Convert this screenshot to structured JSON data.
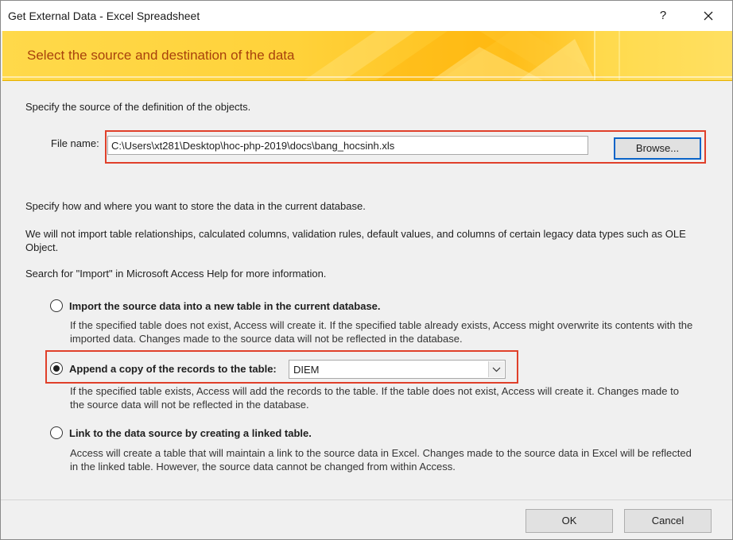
{
  "window": {
    "title": "Get External Data - Excel Spreadsheet",
    "help_label": "?"
  },
  "banner": {
    "title": "Select the source and destination of the data"
  },
  "source": {
    "instruction": "Specify the source of the definition of the objects.",
    "file_label": "File name:",
    "file_value": "C:\\Users\\xt281\\Desktop\\hoc-php-2019\\docs\\bang_hocsinh.xls",
    "browse_label": "Browse..."
  },
  "info": {
    "line1": "Specify how and where you want to store the data in the current database.",
    "line2": "We will not import table relationships, calculated columns, validation rules, default values, and columns of certain legacy data types such as OLE",
    "line2b": "Object.",
    "line3": "Search for \"Import\" in Microsoft Access Help for more information."
  },
  "options": [
    {
      "label": "Import the source data into a new table in the current database.",
      "desc1": "If the specified table does not exist, Access will create it. If the specified table already exists, Access might overwrite its contents with the",
      "desc2": "imported data. Changes made to the source data will not be reflected in the database.",
      "selected": false
    },
    {
      "label": "Append a copy of the records to the table:",
      "table_value": "DIEM",
      "desc1": "If the specified table exists, Access will add the records to the table. If the table does not exist, Access will create it. Changes made to",
      "desc2": "the source data will not be reflected in the database.",
      "selected": true
    },
    {
      "label": "Link to the data source by creating a linked table.",
      "desc1": "Access will create a table that will maintain a link to the source data in Excel. Changes made to the source data in Excel will be reflected",
      "desc2": "in the linked table. However, the source data cannot be changed from within Access.",
      "selected": false
    }
  ],
  "buttons": {
    "ok": "OK",
    "cancel": "Cancel"
  }
}
